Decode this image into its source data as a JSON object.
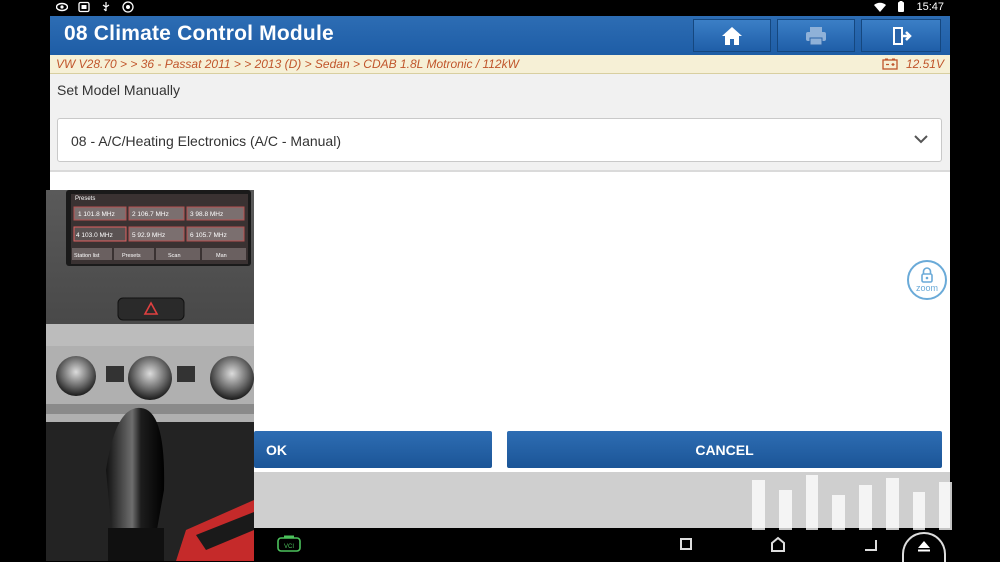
{
  "status_bar": {
    "time": "15:47",
    "left_icons": [
      "eye-icon",
      "screen-icon",
      "usb-icon",
      "debug-icon"
    ],
    "right_icons": [
      "wifi-icon",
      "battery-icon"
    ]
  },
  "header": {
    "title": "08 Climate Control Module",
    "buttons": [
      "home-icon",
      "print-icon",
      "exit-icon"
    ]
  },
  "breadcrumb": {
    "path": "VW V28.70 >  > 36 - Passat 2011 > > 2013 (D) > Sedan > CDAB 1.8L Motronic / 112kW",
    "voltage": "12.51V"
  },
  "model": {
    "label": "Set Model Manually",
    "selected": "08 - A/C/Heating Electronics (A/C - Manual)"
  },
  "zoom": {
    "label": "zoom"
  },
  "actions": {
    "ok_label": "OK",
    "cancel_label": "CANCEL"
  },
  "nav_bar": {
    "vci_label": "VCI"
  },
  "photo": {
    "presets_label": "Presets",
    "stations": [
      "1 101.8 MHz",
      "2 106.7 MHz",
      "3 98.8 MHz",
      "4 103.0 MHz",
      "5 92.9 MHz",
      "6 105.7 MHz"
    ],
    "tabs": [
      "Station list",
      "Presets",
      "Scan",
      "Man"
    ]
  },
  "colors": {
    "header": "#1e5da6",
    "breadcrumb_text": "#c0552b",
    "button": "#2e6db3"
  }
}
